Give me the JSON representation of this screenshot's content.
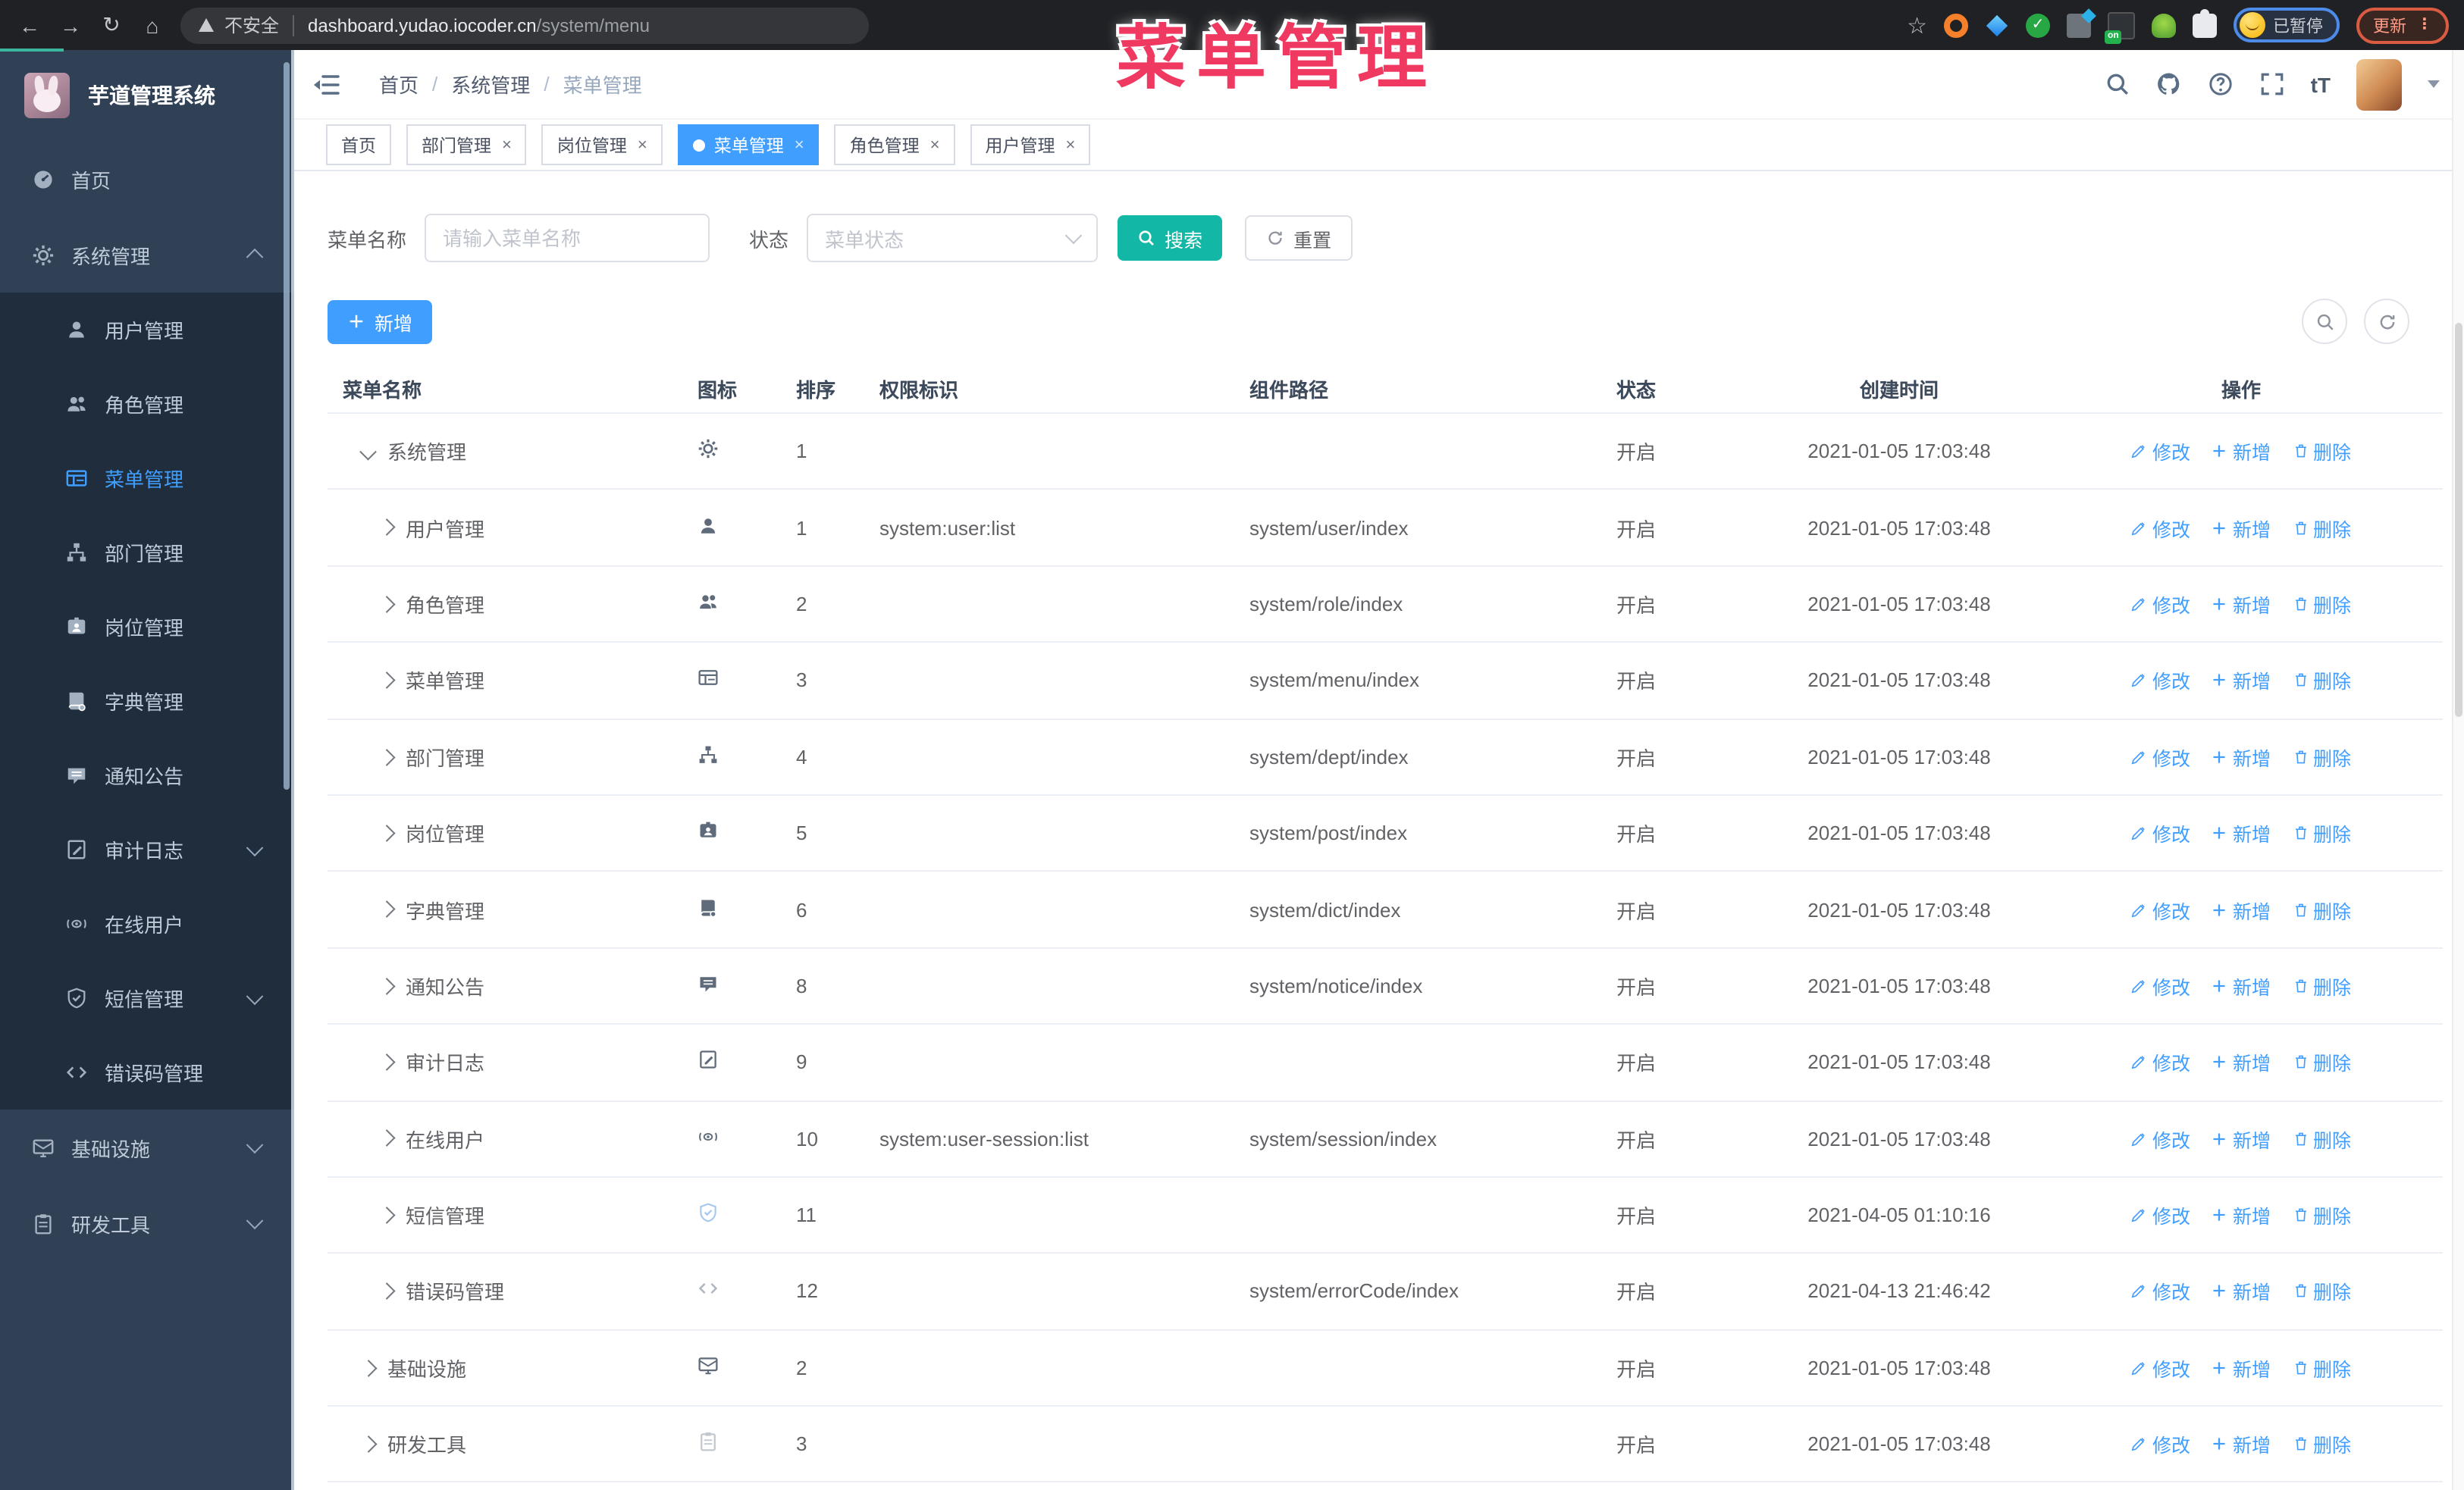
{
  "overlay_title": "菜单管理",
  "browser": {
    "security_label": "不安全",
    "url_host": "dashboard.yudao.iocoder.cn",
    "url_path": "/system/menu",
    "ext_on_badge": "on",
    "paused_badge": "已暂停",
    "update_button": "更新"
  },
  "sidebar": {
    "logo_title": "芋道管理系统",
    "items": [
      {
        "label": "首页",
        "icon": "dashboard",
        "type": "top"
      },
      {
        "label": "系统管理",
        "icon": "gear",
        "type": "top",
        "chevron": "up"
      },
      {
        "label": "用户管理",
        "icon": "user",
        "type": "sub"
      },
      {
        "label": "角色管理",
        "icon": "peoples",
        "type": "sub"
      },
      {
        "label": "菜单管理",
        "icon": "tree-table",
        "type": "sub",
        "active": true
      },
      {
        "label": "部门管理",
        "icon": "tree",
        "type": "sub"
      },
      {
        "label": "岗位管理",
        "icon": "post",
        "type": "sub"
      },
      {
        "label": "字典管理",
        "icon": "dict",
        "type": "sub"
      },
      {
        "label": "通知公告",
        "icon": "message",
        "type": "sub"
      },
      {
        "label": "审计日志",
        "icon": "log",
        "type": "sub",
        "chevron": "down"
      },
      {
        "label": "在线用户",
        "icon": "online",
        "type": "sub"
      },
      {
        "label": "短信管理",
        "icon": "validcode",
        "type": "sub",
        "chevron": "down"
      },
      {
        "label": "错误码管理",
        "icon": "code",
        "type": "sub"
      },
      {
        "label": "基础设施",
        "icon": "monitor",
        "type": "top",
        "chevron": "down"
      },
      {
        "label": "研发工具",
        "icon": "clipboard",
        "type": "top",
        "chevron": "down"
      }
    ]
  },
  "header": {
    "breadcrumb": [
      "首页",
      "系统管理",
      "菜单管理"
    ]
  },
  "tabs": [
    {
      "label": "首页",
      "closable": false,
      "active": false
    },
    {
      "label": "部门管理",
      "closable": true,
      "active": false
    },
    {
      "label": "岗位管理",
      "closable": true,
      "active": false
    },
    {
      "label": "菜单管理",
      "closable": true,
      "active": true
    },
    {
      "label": "角色管理",
      "closable": true,
      "active": false
    },
    {
      "label": "用户管理",
      "closable": true,
      "active": false
    }
  ],
  "search": {
    "name_label": "菜单名称",
    "name_placeholder": "请输入菜单名称",
    "status_label": "状态",
    "status_placeholder": "菜单状态",
    "search_button": "搜索",
    "reset_button": "重置"
  },
  "toolbar": {
    "add_button": "新增"
  },
  "table": {
    "columns": [
      "菜单名称",
      "图标",
      "排序",
      "权限标识",
      "组件路径",
      "状态",
      "创建时间",
      "操作"
    ],
    "actions": {
      "edit": "修改",
      "add": "新增",
      "del": "删除"
    },
    "rows": [
      {
        "name": "系统管理",
        "icon": "gear",
        "expand": "down",
        "indent": 0,
        "order": "1",
        "perm": "",
        "path": "",
        "status": "开启",
        "time": "2021-01-05 17:03:48"
      },
      {
        "name": "用户管理",
        "icon": "user",
        "expand": "right",
        "indent": 1,
        "order": "1",
        "perm": "system:user:list",
        "path": "system/user/index",
        "status": "开启",
        "time": "2021-01-05 17:03:48"
      },
      {
        "name": "角色管理",
        "icon": "peoples",
        "expand": "right",
        "indent": 1,
        "order": "2",
        "perm": "",
        "path": "system/role/index",
        "status": "开启",
        "time": "2021-01-05 17:03:48"
      },
      {
        "name": "菜单管理",
        "icon": "tree-table",
        "expand": "right",
        "indent": 1,
        "order": "3",
        "perm": "",
        "path": "system/menu/index",
        "status": "开启",
        "time": "2021-01-05 17:03:48"
      },
      {
        "name": "部门管理",
        "icon": "tree",
        "expand": "right",
        "indent": 1,
        "order": "4",
        "perm": "",
        "path": "system/dept/index",
        "status": "开启",
        "time": "2021-01-05 17:03:48"
      },
      {
        "name": "岗位管理",
        "icon": "post",
        "expand": "right",
        "indent": 1,
        "order": "5",
        "perm": "",
        "path": "system/post/index",
        "status": "开启",
        "time": "2021-01-05 17:03:48"
      },
      {
        "name": "字典管理",
        "icon": "dict",
        "expand": "right",
        "indent": 1,
        "order": "6",
        "perm": "",
        "path": "system/dict/index",
        "status": "开启",
        "time": "2021-01-05 17:03:48"
      },
      {
        "name": "通知公告",
        "icon": "message",
        "expand": "right",
        "indent": 1,
        "order": "8",
        "perm": "",
        "path": "system/notice/index",
        "status": "开启",
        "time": "2021-01-05 17:03:48"
      },
      {
        "name": "审计日志",
        "icon": "log",
        "expand": "right",
        "indent": 1,
        "order": "9",
        "perm": "",
        "path": "",
        "status": "开启",
        "time": "2021-01-05 17:03:48"
      },
      {
        "name": "在线用户",
        "icon": "online",
        "expand": "right",
        "indent": 1,
        "order": "10",
        "perm": "system:user-session:list",
        "path": "system/session/index",
        "status": "开启",
        "time": "2021-01-05 17:03:48"
      },
      {
        "name": "短信管理",
        "icon": "validcode",
        "icon_color": "#a5c7f0",
        "expand": "right",
        "indent": 1,
        "order": "11",
        "perm": "",
        "path": "",
        "status": "开启",
        "time": "2021-04-05 01:10:16"
      },
      {
        "name": "错误码管理",
        "icon": "code",
        "icon_color": "#b0b6bd",
        "expand": "right",
        "indent": 1,
        "order": "12",
        "perm": "",
        "path": "system/errorCode/index",
        "status": "开启",
        "time": "2021-04-13 21:46:42"
      },
      {
        "name": "基础设施",
        "icon": "monitor",
        "expand": "right",
        "indent": 0,
        "order": "2",
        "perm": "",
        "path": "",
        "status": "开启",
        "time": "2021-01-05 17:03:48"
      },
      {
        "name": "研发工具",
        "icon": "clipboard",
        "icon_color": "#c3c8ce",
        "expand": "right",
        "indent": 0,
        "order": "3",
        "perm": "",
        "path": "",
        "status": "开启",
        "time": "2021-01-05 17:03:48"
      }
    ]
  },
  "colors": {
    "accent": "#409eff",
    "search_button": "#12b7a6",
    "overlay_title": "#ef3960",
    "sidebar_bg": "#304156",
    "submenu_bg": "#1f2d3d",
    "row_text": "#606266"
  }
}
